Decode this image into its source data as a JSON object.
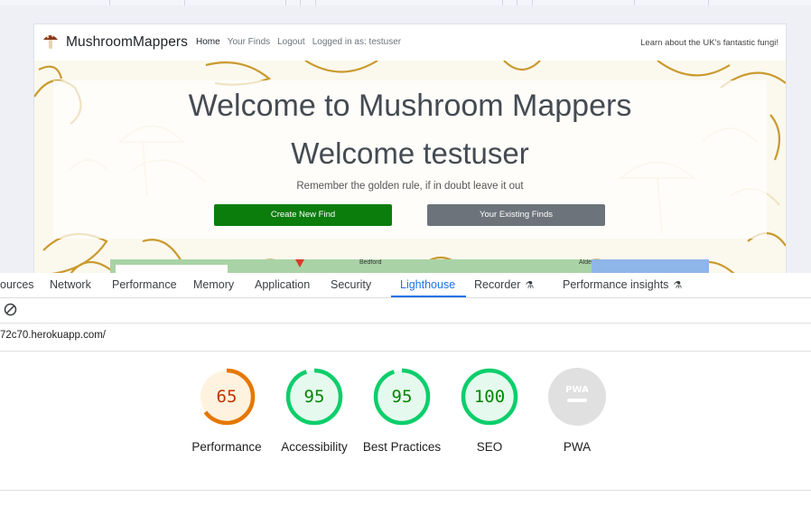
{
  "site": {
    "brand": "MushroomMappers",
    "nav": [
      {
        "label": "Home",
        "active": true
      },
      {
        "label": "Your Finds",
        "active": false
      },
      {
        "label": "Logout",
        "active": false
      },
      {
        "label": "Logged in as: testuser",
        "active": false
      }
    ],
    "tagline": "Learn about the UK's fantastic fungi!",
    "hero": {
      "title": "Welcome to Mushroom Mappers",
      "welcome": "Welcome testuser",
      "rule": "Remember the golden rule, if in doubt leave it out",
      "create_button": "Create New Find",
      "finds_button": "Your Existing Finds"
    },
    "map": {
      "label_bedford": "Bedford",
      "label_aldeburgh": "Aldeburgh"
    }
  },
  "devtools": {
    "tabs": [
      {
        "label": "ources"
      },
      {
        "label": "Network"
      },
      {
        "label": "Performance"
      },
      {
        "label": "Memory"
      },
      {
        "label": "Application"
      },
      {
        "label": "Security"
      },
      {
        "label": "Lighthouse",
        "selected": true
      },
      {
        "label": "Recorder",
        "icon": "flask-icon"
      },
      {
        "label": "Performance insights",
        "icon": "flask-icon"
      }
    ],
    "url": "72c70.herokuapp.com/",
    "scores": [
      {
        "label": "Performance",
        "value": "65",
        "score": 65,
        "color": "#e67700",
        "track": "#fff3e0",
        "text_color": "#c33300"
      },
      {
        "label": "Accessibility",
        "value": "95",
        "score": 95,
        "color": "#0cce6b",
        "track": "#e6f9ee",
        "text_color": "#008800"
      },
      {
        "label": "Best Practices",
        "value": "95",
        "score": 95,
        "color": "#0cce6b",
        "track": "#e6f9ee",
        "text_color": "#008800"
      },
      {
        "label": "SEO",
        "value": "100",
        "score": 100,
        "color": "#0cce6b",
        "track": "#e6f9ee",
        "text_color": "#008800"
      },
      {
        "label": "PWA",
        "value": "PWA",
        "color": "#bdbdbd",
        "track": "#e0e0e0"
      }
    ]
  }
}
